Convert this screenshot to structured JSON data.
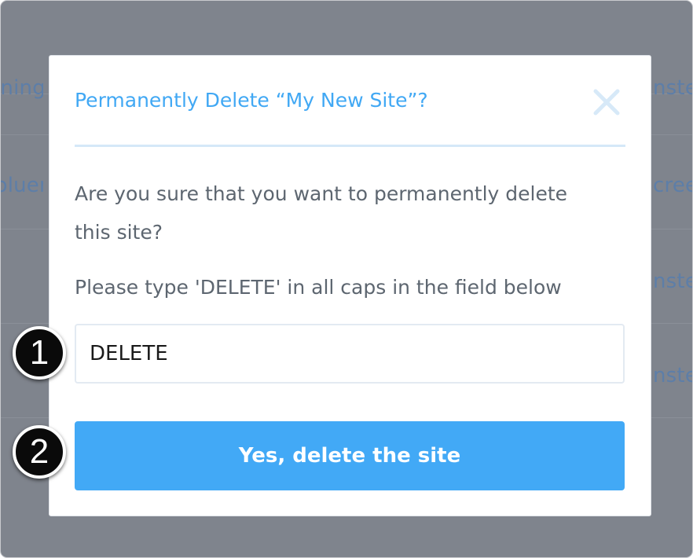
{
  "background": {
    "rows": [
      {
        "left": "ining",
        "right": "nste"
      },
      {
        "left": "bluer",
        "right": "creen"
      },
      {
        "left": "",
        "right": "nste"
      },
      {
        "left": "",
        "right": "nste"
      }
    ]
  },
  "modal": {
    "title": "Permanently Delete “My New Site”?",
    "close_icon": "close-icon",
    "question": "Are you sure that you want to permanently delete this site?",
    "instruction": "Please type 'DELETE' in all caps in the field below",
    "input_value": "DELETE",
    "confirm_button_label": "Yes, delete the site"
  },
  "annotations": {
    "step1": "1",
    "step2": "2"
  },
  "colors": {
    "accent": "#42a9f6",
    "title": "#41a8f4",
    "overlay": "#7f848d"
  }
}
